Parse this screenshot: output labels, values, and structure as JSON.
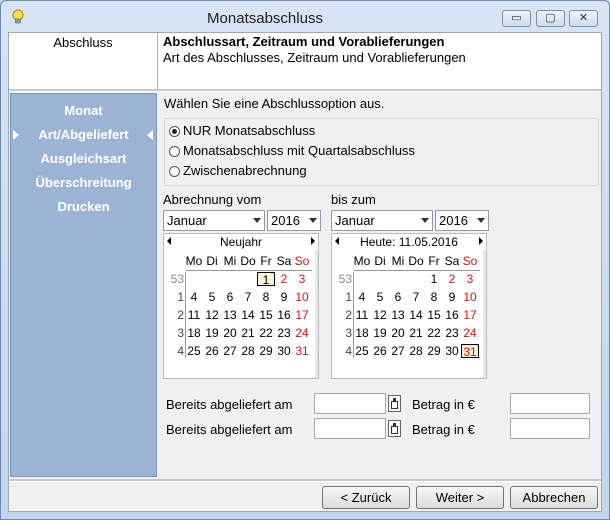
{
  "window": {
    "title": "Monatsabschluss",
    "minimize": "▭",
    "maximize": "▢",
    "close": "✕"
  },
  "header": {
    "section": "Abschluss",
    "title": "Abschlussart,  Zeitraum und Vorablieferungen",
    "subtitle": "Art des Abschlusses, Zeitraum und Vorablieferungen"
  },
  "nav": {
    "items": [
      "Monat",
      "Art/Abgeliefert",
      "Ausgleichsart",
      "Überschreitung",
      "Drucken"
    ],
    "active_index": 1
  },
  "options": {
    "prompt": "Wählen Sie eine Abschlussoption aus.",
    "radios": [
      {
        "label": "NUR Monatsabschluss",
        "checked": true
      },
      {
        "label": "Monatsabschluss mit Quartalsabschluss",
        "checked": false
      },
      {
        "label": "Zwischenabrechnung",
        "checked": false
      }
    ]
  },
  "from": {
    "label": "Abrechnung vom",
    "month": "Januar",
    "year": "2016",
    "calendar": {
      "header": "Neujahr",
      "weekdays": [
        "Mo",
        "Di",
        "Mi",
        "Do",
        "Fr",
        "Sa",
        "So"
      ],
      "weeks": [
        {
          "wk": "53",
          "days": [
            "",
            "",
            "",
            "",
            "1",
            "2",
            "3"
          ]
        },
        {
          "wk": "1",
          "days": [
            "4",
            "5",
            "6",
            "7",
            "8",
            "9",
            "10"
          ]
        },
        {
          "wk": "2",
          "days": [
            "11",
            "12",
            "13",
            "14",
            "15",
            "16",
            "17"
          ]
        },
        {
          "wk": "3",
          "days": [
            "18",
            "19",
            "20",
            "21",
            "22",
            "23",
            "24"
          ]
        },
        {
          "wk": "4",
          "days": [
            "25",
            "26",
            "27",
            "28",
            "29",
            "30",
            "31"
          ]
        }
      ],
      "selected": "1"
    }
  },
  "to": {
    "label": "bis zum",
    "month": "Januar",
    "year": "2016",
    "calendar": {
      "header": "Heute: 11.05.2016",
      "weekdays": [
        "Mo",
        "Di",
        "Mi",
        "Do",
        "Fr",
        "Sa",
        "So"
      ],
      "weeks": [
        {
          "wk": "53",
          "days": [
            "",
            "",
            "",
            "",
            "1",
            "2",
            "3"
          ]
        },
        {
          "wk": "1",
          "days": [
            "4",
            "5",
            "6",
            "7",
            "8",
            "9",
            "10"
          ]
        },
        {
          "wk": "2",
          "days": [
            "11",
            "12",
            "13",
            "14",
            "15",
            "16",
            "17"
          ]
        },
        {
          "wk": "3",
          "days": [
            "18",
            "19",
            "20",
            "21",
            "22",
            "23",
            "24"
          ]
        },
        {
          "wk": "4",
          "days": [
            "25",
            "26",
            "27",
            "28",
            "29",
            "30",
            "31"
          ]
        }
      ],
      "selected": "31"
    }
  },
  "deliveries": [
    {
      "label": "Bereits abgeliefert am",
      "date": "",
      "amount_label": "Betrag in €",
      "amount": ""
    },
    {
      "label": "Bereits abgeliefert am",
      "date": "",
      "amount_label": "Betrag in €",
      "amount": ""
    }
  ],
  "buttons": {
    "back": "< Zurück",
    "next": "Weiter >",
    "cancel": "Abbrechen"
  },
  "colors": {
    "nav_bg": "#9bb4d4",
    "sunday": "#d11111",
    "weekend_holiday_red": "#d11111"
  }
}
